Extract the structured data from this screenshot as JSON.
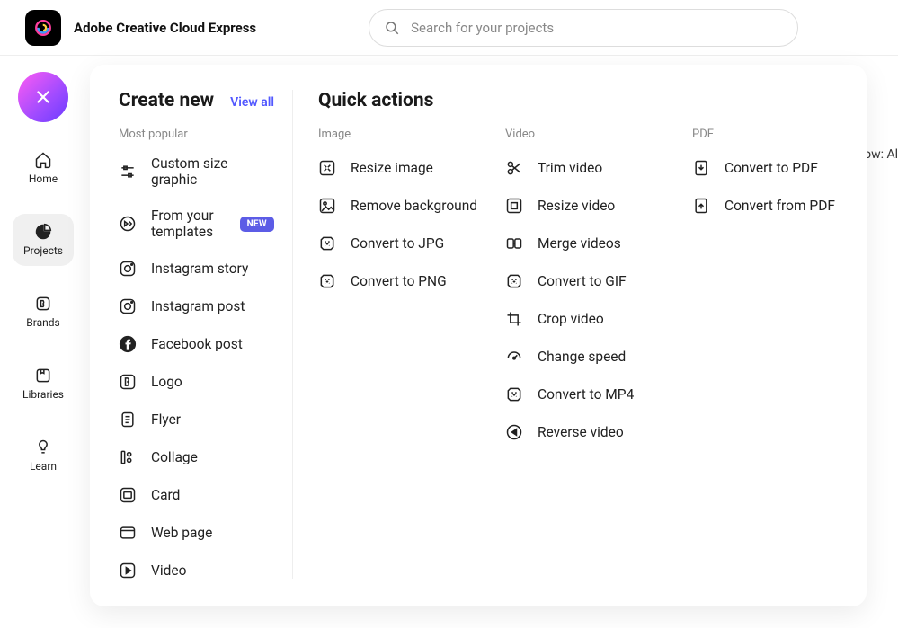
{
  "app": {
    "title": "Adobe Creative Cloud Express"
  },
  "search": {
    "placeholder": "Search for your projects"
  },
  "sidebar": {
    "items": [
      {
        "label": "Home"
      },
      {
        "label": "Projects"
      },
      {
        "label": "Brands"
      },
      {
        "label": "Libraries"
      },
      {
        "label": "Learn"
      }
    ]
  },
  "panel": {
    "create_title": "Create new",
    "view_all": "View all",
    "most_popular": "Most popular",
    "items": [
      {
        "label": "Custom size graphic"
      },
      {
        "label": "From your templates",
        "badge": "NEW"
      },
      {
        "label": "Instagram story"
      },
      {
        "label": "Instagram post"
      },
      {
        "label": "Facebook post"
      },
      {
        "label": "Logo"
      },
      {
        "label": "Flyer"
      },
      {
        "label": "Collage"
      },
      {
        "label": "Card"
      },
      {
        "label": "Web page"
      },
      {
        "label": "Video"
      }
    ],
    "quick_title": "Quick actions",
    "quick": {
      "image": {
        "head": "Image",
        "items": [
          {
            "label": "Resize image"
          },
          {
            "label": "Remove background"
          },
          {
            "label": "Convert to JPG"
          },
          {
            "label": "Convert to PNG"
          }
        ]
      },
      "video": {
        "head": "Video",
        "items": [
          {
            "label": "Trim video"
          },
          {
            "label": "Resize video"
          },
          {
            "label": "Merge videos"
          },
          {
            "label": "Convert to GIF"
          },
          {
            "label": "Crop video"
          },
          {
            "label": "Change speed"
          },
          {
            "label": "Convert to MP4"
          },
          {
            "label": "Reverse video"
          }
        ]
      },
      "pdf": {
        "head": "PDF",
        "items": [
          {
            "label": "Convert to PDF"
          },
          {
            "label": "Convert from PDF"
          }
        ]
      }
    }
  },
  "bg_fragment": "ow: Al"
}
